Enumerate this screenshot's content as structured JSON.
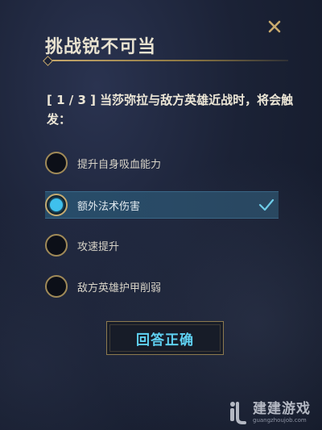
{
  "title": "挑战锐不可当",
  "close_icon": "close-icon",
  "question": "[ 1 / 3 ] 当莎弥拉与敌方英雄近战时，将会触发：",
  "options": [
    {
      "label": "提升自身吸血能力",
      "selected": false
    },
    {
      "label": "额外法术伤害",
      "selected": true
    },
    {
      "label": "攻速提升",
      "selected": false
    },
    {
      "label": "敌方英雄护甲削弱",
      "selected": false
    }
  ],
  "submit_label": "回答正确",
  "watermark": {
    "text": "建建游戏",
    "url": "guangzhoujob.com"
  },
  "colors": {
    "gold": "#c8aa6e",
    "accent": "#3fc0ec",
    "selected_bg": "#2c4e68"
  }
}
